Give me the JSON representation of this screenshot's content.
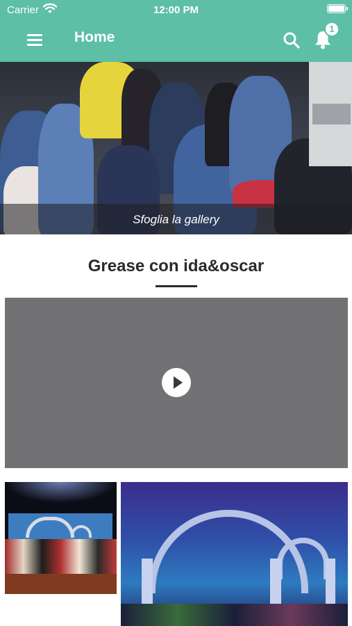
{
  "status_bar": {
    "carrier": "Carrier",
    "time": "12:00 PM"
  },
  "nav": {
    "title": "Home",
    "notification_count": "1"
  },
  "hero": {
    "caption": "Sfoglia la gallery"
  },
  "section": {
    "title": "Grease con ida&oscar"
  },
  "colors": {
    "accent": "#5cbfa6",
    "video_placeholder": "#727275"
  },
  "icons": [
    "menu-icon",
    "search-icon",
    "bell-icon",
    "play-icon",
    "wifi-icon",
    "battery-icon"
  ]
}
